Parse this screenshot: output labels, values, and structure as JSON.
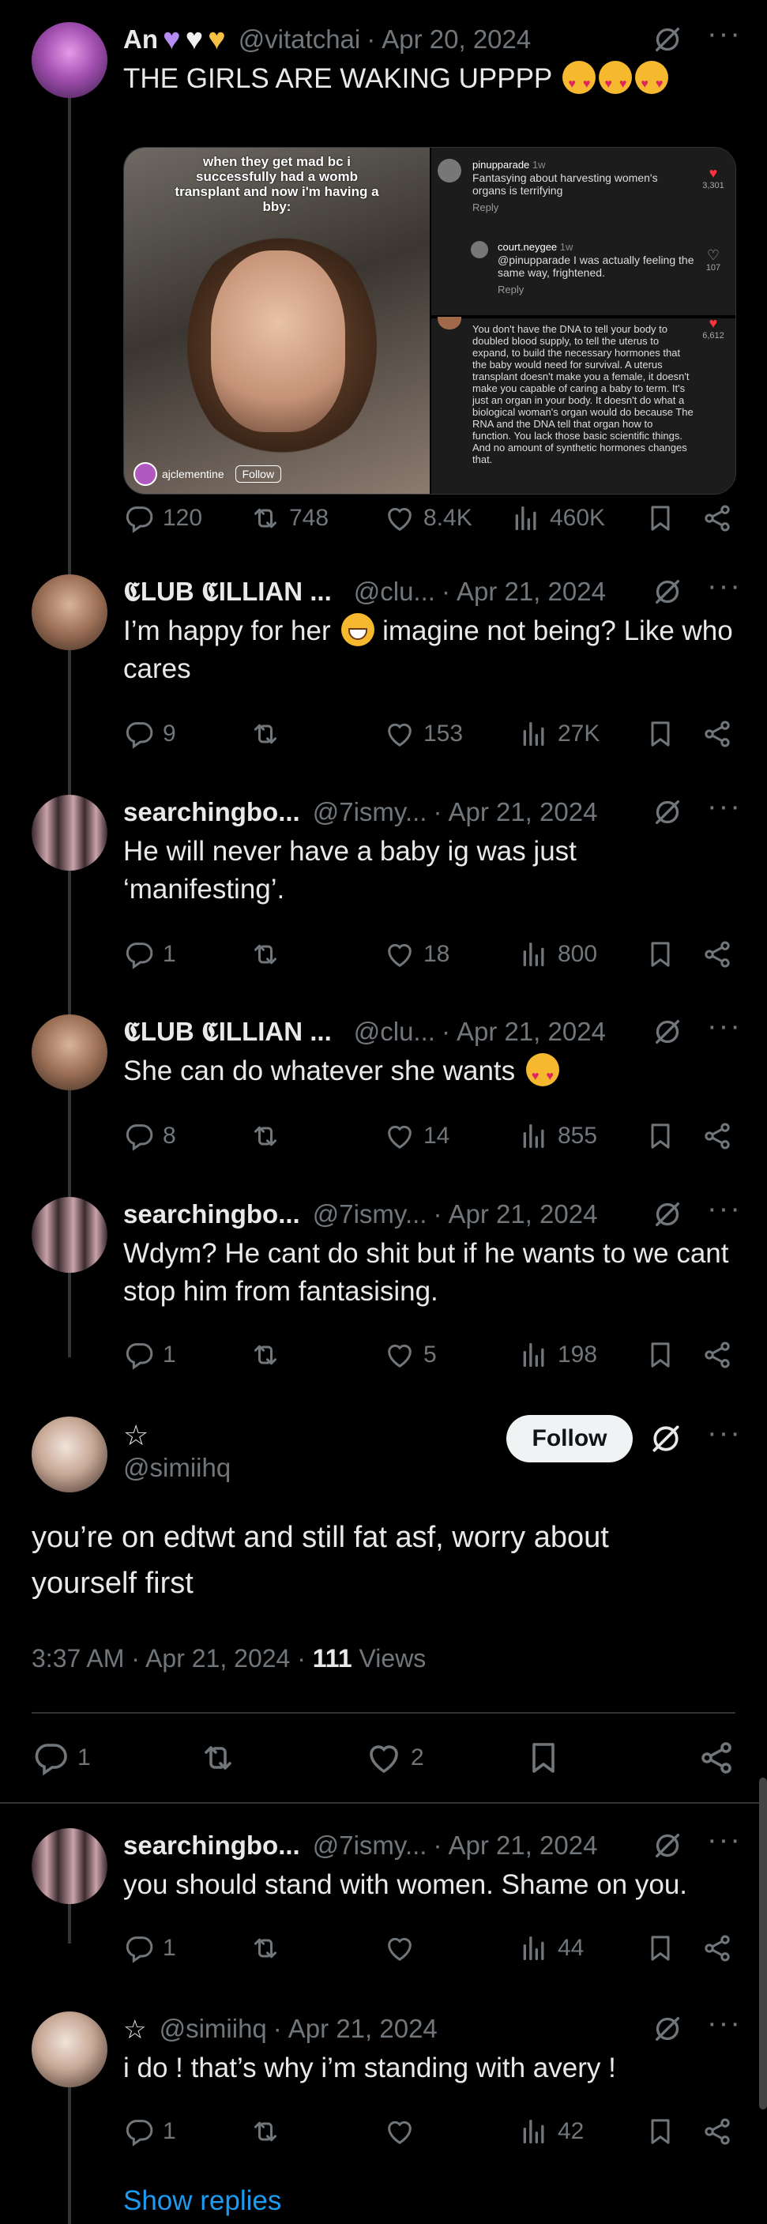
{
  "colors": {
    "background": "#000000",
    "text": "#e7e9ea",
    "muted": "#71767b",
    "link": "#1d9bf0",
    "divider": "#2f3336"
  },
  "tweets": [
    {
      "name": "An",
      "name_badges": [
        "purple-heart",
        "white-heart",
        "yellow-heart"
      ],
      "handle": "@vitatchai",
      "sep": "·",
      "date": "Apr 20, 2024",
      "text": "THE GIRLS ARE WAKING UPPPP",
      "emojis": [
        "heart-eyes",
        "heart-eyes",
        "heart-eyes"
      ],
      "stats": {
        "replies": "120",
        "retweets": "748",
        "likes": "8.4K",
        "views": "460K"
      },
      "media": {
        "caption": "when they get mad bc i successfully had a womb transplant and now i'm having a bby:",
        "video_user": "ajclementine",
        "video_follow": "Follow",
        "comments": [
          {
            "user": "pinupparade",
            "time": "1w",
            "text": "Fantasying about harvesting women's organs is terrifying",
            "reply": "Reply",
            "likes": "3,301"
          },
          {
            "user": "court.neygee",
            "time": "1w",
            "text": "@pinupparade I was actually feeling the same way, frightened.",
            "reply": "Reply",
            "likes": "107"
          },
          {
            "user": "",
            "time": "",
            "text": "You don't have the DNA to tell your body to doubled blood supply, to tell the uterus to expand, to build the necessary hormones that the baby would need for survival. A uterus transplant doesn't make you a female, it doesn't make you capable of caring a baby to term. It's just an organ in your body. It doesn't do what a biological woman's organ would do because The RNA and the DNA tell that organ how to function. You lack those basic scientific things. And no amount of synthetic hormones changes that.",
            "reply": "",
            "likes": "6,612"
          }
        ]
      }
    },
    {
      "name": "𝕮LUB 𝕮ILLIAN ...",
      "handle": "@clu...",
      "sep": "·",
      "date": "Apr 21, 2024",
      "text": "I’m happy for her",
      "text2": "imagine not being? Like who cares",
      "stats": {
        "replies": "9",
        "retweets": "",
        "likes": "153",
        "views": "27K"
      }
    },
    {
      "name": "searchingbo...",
      "handle": "@7ismy...",
      "sep": "·",
      "date": "Apr 21, 2024",
      "text": "He will never have a baby ig was just ‘manifesting’.",
      "stats": {
        "replies": "1",
        "retweets": "",
        "likes": "18",
        "views": "800"
      }
    },
    {
      "name": "𝕮LUB 𝕮ILLIAN ...",
      "handle": "@clu...",
      "sep": "·",
      "date": "Apr 21, 2024",
      "text": "She can do whatever she wants",
      "stats": {
        "replies": "8",
        "retweets": "",
        "likes": "14",
        "views": "855"
      }
    },
    {
      "name": "searchingbo...",
      "handle": "@7ismy...",
      "sep": "·",
      "date": "Apr 21, 2024",
      "text": "Wdym? He cant do shit but if he wants to we cant stop him from fantasising.",
      "stats": {
        "replies": "1",
        "retweets": "",
        "likes": "5",
        "views": "198"
      }
    }
  ],
  "focus": {
    "name": "☆",
    "handle": "@simiihq",
    "follow_label": "Follow",
    "text": "you’re on edtwt and still fat asf, worry about yourself first",
    "time": "3:37 AM",
    "sep": "·",
    "date": "Apr 21, 2024",
    "views_count": "111",
    "views_label": "Views",
    "stats": {
      "replies": "1",
      "retweets": "",
      "likes": "2"
    }
  },
  "replies": [
    {
      "name": "searchingbo...",
      "handle": "@7ismy...",
      "sep": "·",
      "date": "Apr 21, 2024",
      "text": "you should stand with women. Shame on you.",
      "stats": {
        "replies": "1",
        "retweets": "",
        "likes": "",
        "views": "44"
      }
    },
    {
      "name": "☆",
      "handle": "@simiihq",
      "sep": "·",
      "date": "Apr 21, 2024",
      "text": "i do ! that’s why i’m standing with avery !",
      "stats": {
        "replies": "1",
        "retweets": "",
        "likes": "",
        "views": "42"
      }
    }
  ],
  "show_replies": "Show replies"
}
